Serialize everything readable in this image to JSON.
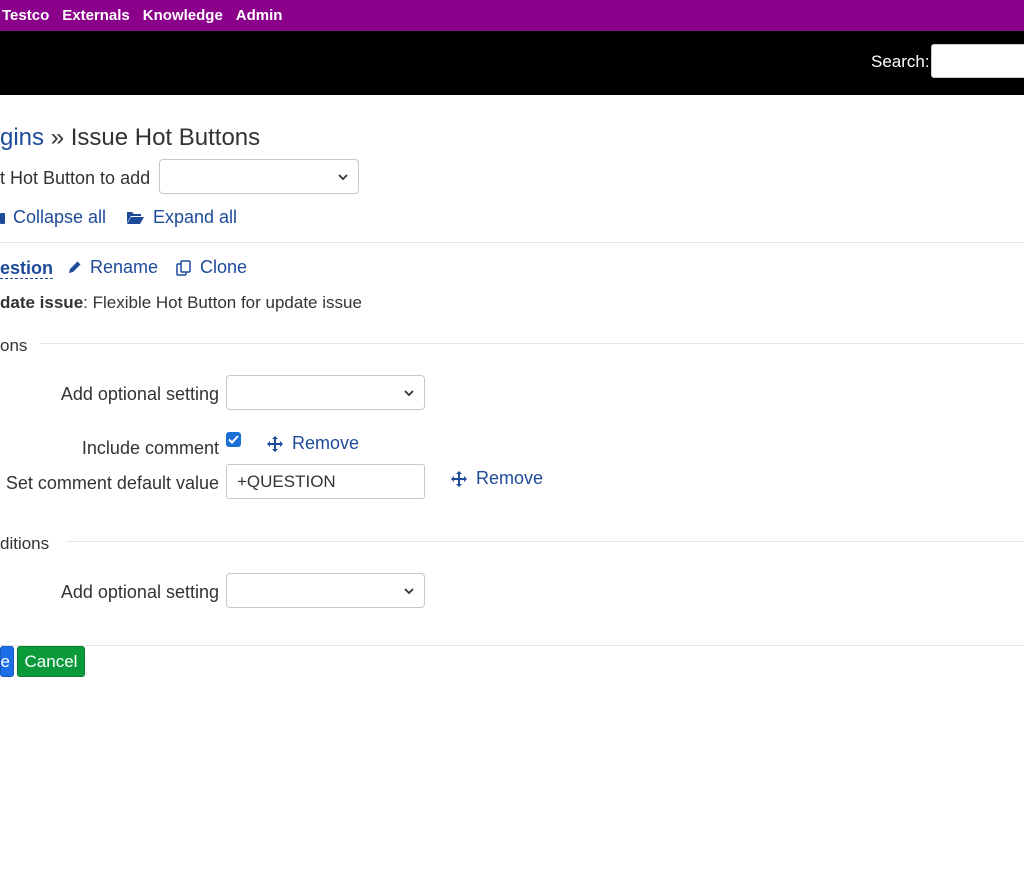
{
  "nav": {
    "items": [
      "Testco",
      "Externals",
      "Knowledge",
      "Admin"
    ]
  },
  "search": {
    "label": "Search:",
    "value": ""
  },
  "title": {
    "breadcrumb_link": "gins",
    "separator": " » ",
    "current": "Issue Hot Buttons"
  },
  "add_hot_button": {
    "label": "t Hot Button to add",
    "selected": ""
  },
  "tree_controls": {
    "collapse_label": "Collapse all",
    "expand_label": "Expand all"
  },
  "hot_button": {
    "name_tab": "estion",
    "rename_label": "Rename",
    "clone_label": "Clone",
    "description_bold": "date issue",
    "description_rest": ": Flexible Hot Button for update issue"
  },
  "actions_section": {
    "legend": "ons",
    "add_optional_label": "Add optional setting",
    "add_optional_selected": "",
    "include_comment_label": "Include comment",
    "include_comment_checked": true,
    "include_comment_remove": "Remove",
    "default_value_label": "Set comment default value",
    "default_value": "+QUESTION",
    "default_value_remove": "Remove"
  },
  "conditions_section": {
    "legend": "ditions",
    "add_optional_label": "Add optional setting",
    "add_optional_selected": ""
  },
  "buttons": {
    "save_label": "e",
    "cancel_label": "Cancel"
  },
  "colors": {
    "nav_bg": "#8b008b",
    "header_bg": "#000000",
    "link": "#1e4a9a",
    "save_bg": "#1a6fe8",
    "cancel_bg": "#0a9a3c"
  }
}
